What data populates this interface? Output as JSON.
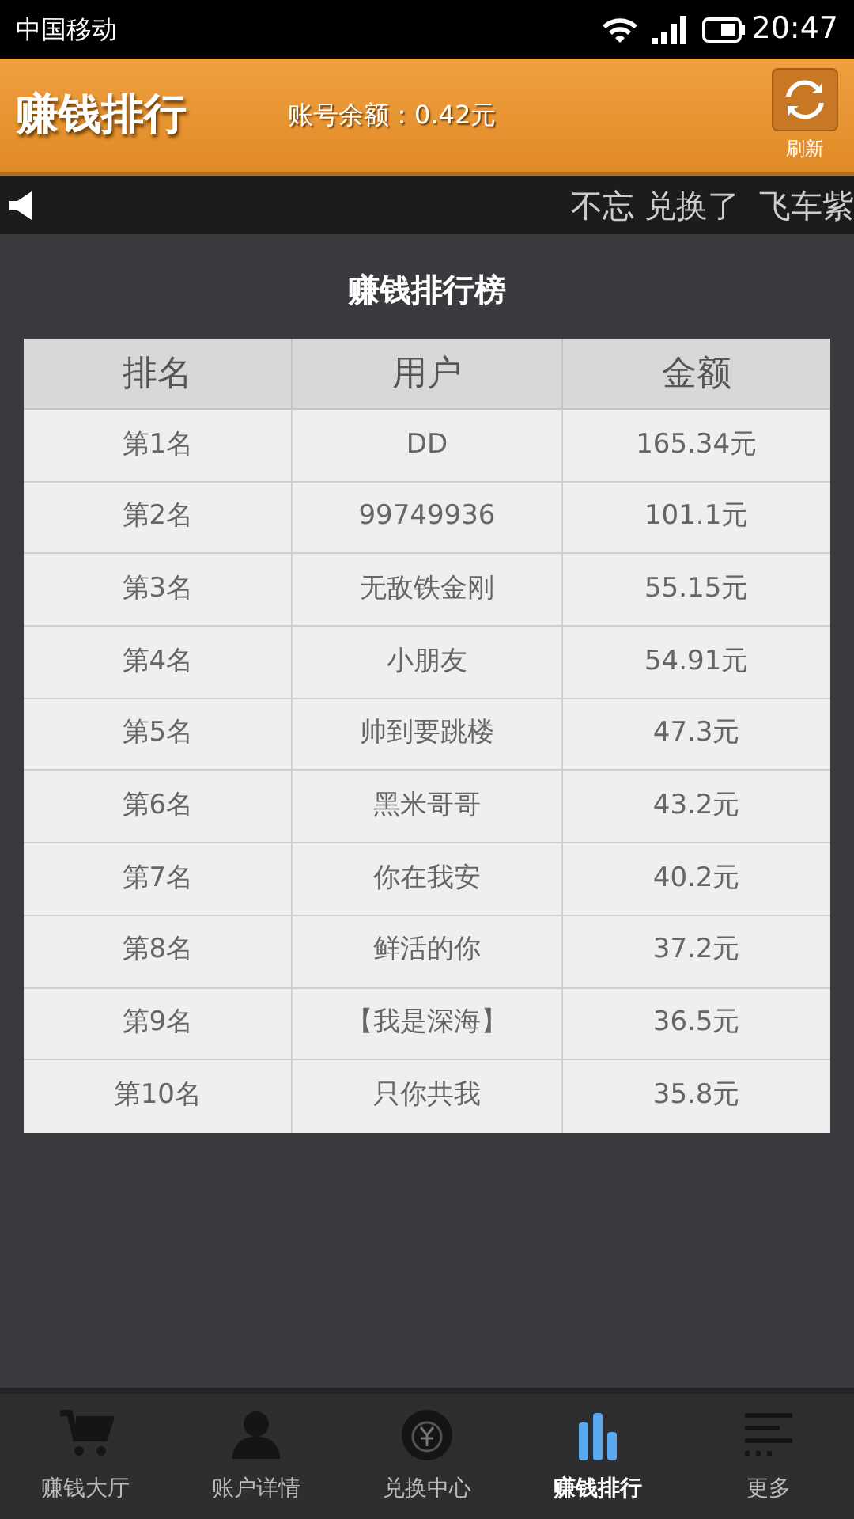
{
  "status_bar": {
    "carrier": "中国移动",
    "time": "20:47"
  },
  "header": {
    "title": "赚钱排行",
    "balance": "账号余额：0.42元",
    "refresh_label": "刷新"
  },
  "ticker": {
    "text": "不忘 兑换了  飞车紫"
  },
  "ranking": {
    "title": "赚钱排行榜",
    "columns": [
      "排名",
      "用户",
      "金额"
    ],
    "rows": [
      [
        "第1名",
        "DD",
        "165.34元"
      ],
      [
        "第2名",
        "99749936",
        "101.1元"
      ],
      [
        "第3名",
        "无敌铁金刚",
        "55.15元"
      ],
      [
        "第4名",
        "小朋友",
        "54.91元"
      ],
      [
        "第5名",
        "帅到要跳楼",
        "47.3元"
      ],
      [
        "第6名",
        "黑米哥哥",
        "43.2元"
      ],
      [
        "第7名",
        "你在我安",
        "40.2元"
      ],
      [
        "第8名",
        "鲜活的你",
        "37.2元"
      ],
      [
        "第9名",
        "【我是深海】",
        "36.5元"
      ],
      [
        "第10名",
        "只你共我",
        "35.8元"
      ]
    ]
  },
  "tab_bar": [
    {
      "label": "赚钱大厅",
      "selected": false
    },
    {
      "label": "账户详情",
      "selected": false
    },
    {
      "label": "兑换中心",
      "selected": false
    },
    {
      "label": "赚钱排行",
      "selected": true
    },
    {
      "label": "更多",
      "selected": false
    }
  ]
}
